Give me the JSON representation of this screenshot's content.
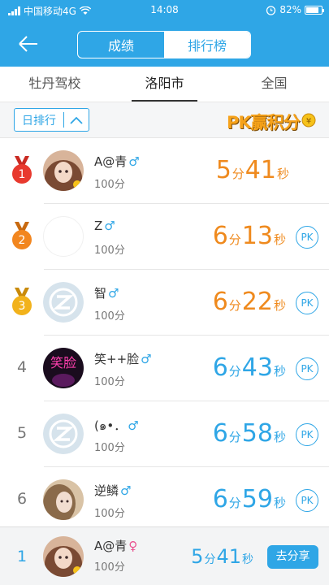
{
  "statusbar": {
    "carrier": "中国移动4G",
    "time": "14:08",
    "battery": "82%",
    "battery_level": 0.82
  },
  "header": {
    "segments": [
      "成绩",
      "排行榜"
    ],
    "active_segment": "排行榜"
  },
  "tabs": [
    {
      "label": "牡丹驾校",
      "active": false
    },
    {
      "label": "洛阳市",
      "active": true
    },
    {
      "label": "全国",
      "active": false
    }
  ],
  "filter": {
    "label": "日排行",
    "pk_banner": "PK赢积分"
  },
  "rankings": [
    {
      "rank": "1",
      "name": "A@青",
      "gender": "♂",
      "score": "100分",
      "min": "5",
      "sec": "41",
      "unit_min": "分",
      "unit_sec": "秒",
      "pk": ""
    },
    {
      "rank": "2",
      "name": "Z",
      "gender": "♂",
      "score": "100分",
      "min": "6",
      "sec": "13",
      "unit_min": "分",
      "unit_sec": "秒",
      "pk": "PK"
    },
    {
      "rank": "3",
      "name": "智",
      "gender": "♂",
      "score": "100分",
      "min": "6",
      "sec": "22",
      "unit_min": "分",
      "unit_sec": "秒",
      "pk": "PK"
    },
    {
      "rank": "4",
      "name": "笑++脸",
      "gender": "♂",
      "score": "100分",
      "min": "6",
      "sec": "43",
      "unit_min": "分",
      "unit_sec": "秒",
      "pk": "PK"
    },
    {
      "rank": "5",
      "name": "(๑•．",
      "gender": "♂",
      "score": "100分",
      "min": "6",
      "sec": "58",
      "unit_min": "分",
      "unit_sec": "秒",
      "pk": "PK"
    },
    {
      "rank": "6",
      "name": "逆鳞",
      "gender": "♂",
      "score": "100分",
      "min": "6",
      "sec": "59",
      "unit_min": "分",
      "unit_sec": "秒",
      "pk": "PK"
    }
  ],
  "me": {
    "rank": "1",
    "name": "A@青",
    "gender": "♀",
    "score": "100分",
    "min": "5",
    "sec": "41",
    "unit_min": "分",
    "unit_sec": "秒",
    "share": "去分享"
  },
  "colors": {
    "primary": "#2fa6e6",
    "orange": "#ef8a1e",
    "gold": "#f2b21b",
    "red": "#e8392e",
    "bronze": "#f2861f"
  }
}
